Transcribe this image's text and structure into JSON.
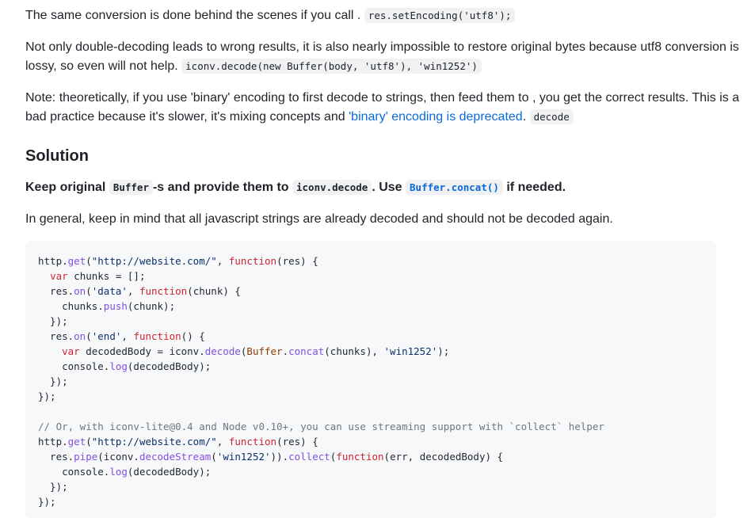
{
  "p1": {
    "text_before": "The same conversion is done behind the scenes if you call .",
    "code": "res.setEncoding('utf8');"
  },
  "p2": {
    "text": "Not only double-decoding leads to wrong results, it is also nearly impossible to restore original bytes because utf8 conversion is lossy, so even will not help.",
    "code": "iconv.decode(new Buffer(body, 'utf8'), 'win1252')"
  },
  "p3": {
    "text": "Note: theoretically, if you use 'binary' encoding to first decode to strings, then feed them to , you get the correct results. This is a bad practice because it's slower, it's mixing concepts and",
    "link": "'binary' encoding is deprecated",
    "after_link": ".",
    "code": "decode"
  },
  "heading": "Solution",
  "p4": {
    "part1": "Keep original",
    "code1": "Buffer",
    "part2": "-s and provide them to",
    "code2": "iconv.decode",
    "part3": ". Use",
    "code3": "Buffer.concat()",
    "part4": "if needed."
  },
  "p5": "In general, keep in mind that all javascript strings are already decoded and should not be decoded again.",
  "code_block": {
    "lines": [
      "http.get(\"http://website.com/\", function(res) {",
      "  var chunks = [];",
      "  res.on('data', function(chunk) {",
      "    chunks.push(chunk);",
      "  });",
      "  res.on('end', function() {",
      "    var decodedBody = iconv.decode(Buffer.concat(chunks), 'win1252');",
      "    console.log(decodedBody);",
      "  });",
      "});",
      "",
      "// Or, with iconv-lite@0.4 and Node v0.10+, you can use streaming support with `collect` helper",
      "http.get(\"http://website.com/\", function(res) {",
      "  res.pipe(iconv.decodeStream('win1252')).collect(function(err, decodedBody) {",
      "    console.log(decodedBody);",
      "  });",
      "});"
    ]
  }
}
